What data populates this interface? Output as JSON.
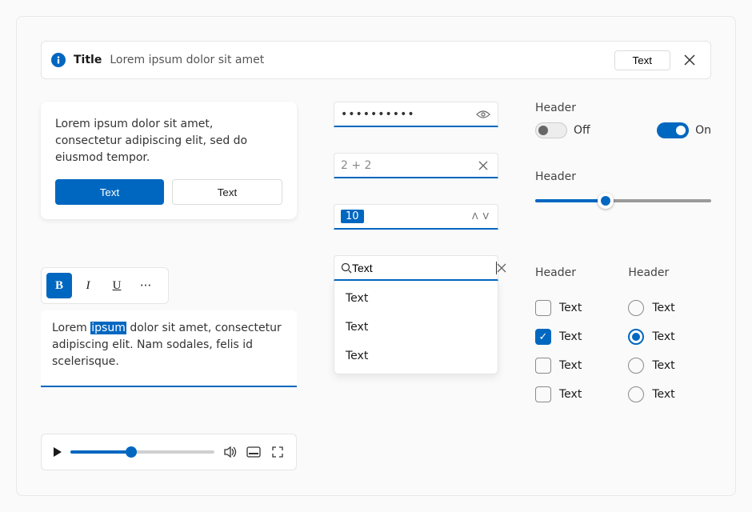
{
  "infobar": {
    "title": "Title",
    "message": "Lorem ipsum dolor sit amet",
    "action_label": "Text"
  },
  "card": {
    "body": "Lorem ipsum dolor sit amet, consectetur adipiscing elit, sed do eiusmod tempor.",
    "primary_label": "Text",
    "secondary_label": "Text"
  },
  "editor": {
    "toolbar": {
      "bold": "B",
      "italic": "I",
      "underline": "U",
      "more": "···"
    },
    "text_before": "Lorem ",
    "text_selected": "ipsum",
    "text_after": " dolor sit amet, consectetur adipiscing elit. Nam sodales, felis id scelerisque."
  },
  "player": {
    "position_pct": 42
  },
  "password": {
    "masked": "••••••••••"
  },
  "math": {
    "placeholder": "2 + 2"
  },
  "spin": {
    "value": "10"
  },
  "search": {
    "value": "Text",
    "options": [
      "Text",
      "Text",
      "Text"
    ]
  },
  "toggles": {
    "header": "Header",
    "off_label": "Off",
    "on_label": "On"
  },
  "slider": {
    "header": "Header",
    "value_pct": 40
  },
  "checkboxes": {
    "header": "Header",
    "items": [
      {
        "label": "Text",
        "checked": false
      },
      {
        "label": "Text",
        "checked": true
      },
      {
        "label": "Text",
        "checked": false
      },
      {
        "label": "Text",
        "checked": false
      }
    ]
  },
  "radios": {
    "header": "Header",
    "items": [
      {
        "label": "Text",
        "checked": false
      },
      {
        "label": "Text",
        "checked": true
      },
      {
        "label": "Text",
        "checked": false
      },
      {
        "label": "Text",
        "checked": false
      }
    ]
  },
  "colors": {
    "accent": "#0067c0"
  }
}
